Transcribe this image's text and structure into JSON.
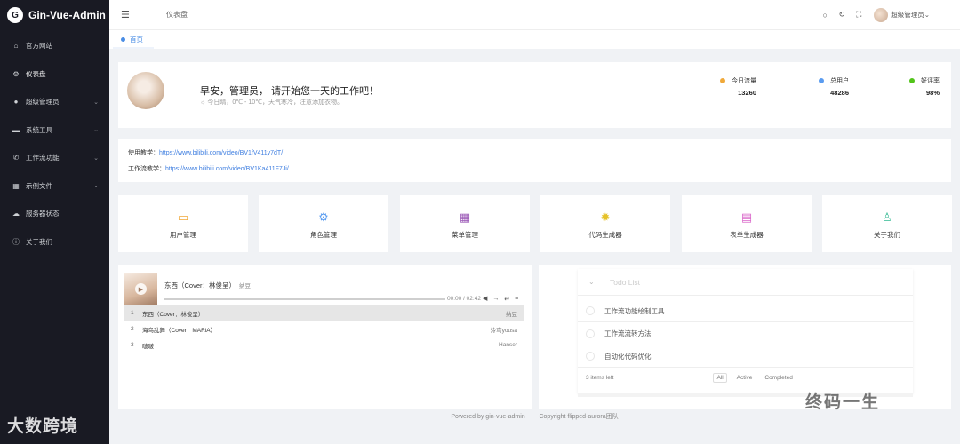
{
  "app": {
    "title": "Gin-Vue-Admin",
    "logo_glyph": "G"
  },
  "sidebar": {
    "items": [
      {
        "label": "官方网站",
        "icon": "home-icon",
        "glyph": "⌂",
        "has_arrow": false
      },
      {
        "label": "仪表盘",
        "icon": "gear-icon",
        "glyph": "⚙",
        "has_arrow": false,
        "active": true
      },
      {
        "label": "超级管理员",
        "icon": "user-icon",
        "glyph": "●",
        "has_arrow": true
      },
      {
        "label": "系统工具",
        "icon": "toolbox-icon",
        "glyph": "▬",
        "has_arrow": true
      },
      {
        "label": "工作流功能",
        "icon": "phone-icon",
        "glyph": "✆",
        "has_arrow": true
      },
      {
        "label": "示例文件",
        "icon": "grid-icon",
        "glyph": "▦",
        "has_arrow": true
      },
      {
        "label": "服务器状态",
        "icon": "cloud-icon",
        "glyph": "☁",
        "has_arrow": false
      },
      {
        "label": "关于我们",
        "icon": "info-icon",
        "glyph": "ⓘ",
        "has_arrow": false
      }
    ],
    "arrow_glyph": "⌄"
  },
  "header": {
    "breadcrumb": "仪表盘",
    "hamburger_glyph": "☰",
    "icons": [
      {
        "name": "search-icon",
        "glyph": "○"
      },
      {
        "name": "refresh-icon",
        "glyph": "↻"
      },
      {
        "name": "fullscreen-icon",
        "glyph": "⛶"
      }
    ],
    "user_name": "超级管理员",
    "dropdown_glyph": "⌄"
  },
  "tabs": [
    {
      "label": "首页",
      "active": true
    }
  ],
  "welcome": {
    "greeting": "早安，管理员， 请开始您一天的工作吧！",
    "weather": "☼ 今日晴，0℃ - 10℃，天气寒冷，注意添加衣物。",
    "stats": [
      {
        "label": "今日流量",
        "value": "13260",
        "color": "#f0a93a"
      },
      {
        "label": "总用户",
        "value": "48286",
        "color": "#5a9cf0"
      },
      {
        "label": "好评率",
        "value": "98%",
        "color": "#52c41a"
      }
    ]
  },
  "links": {
    "usage_label": "使用教学：",
    "usage_url": "https://www.bilibili.com/video/BV1fV411y7dT/",
    "workflow_label": "工作流教学：",
    "workflow_url": "https://www.bilibili.com/video/BV1Ka411F7Ji/"
  },
  "quick_entries": [
    {
      "label": "用户管理",
      "icon": "monitor-icon",
      "glyph": "▭",
      "color": "#f0a93a"
    },
    {
      "label": "角色管理",
      "icon": "settings-icon",
      "glyph": "⚙",
      "color": "#5a9cf0"
    },
    {
      "label": "菜单管理",
      "icon": "menu-grid-icon",
      "glyph": "▦",
      "color": "#9b59b6"
    },
    {
      "label": "代码生成器",
      "icon": "cog-icon",
      "glyph": "✹",
      "color": "#e6c229"
    },
    {
      "label": "表单生成器",
      "icon": "document-icon",
      "glyph": "▤",
      "color": "#d966c9"
    },
    {
      "label": "关于我们",
      "icon": "user-outline-icon",
      "glyph": "♙",
      "color": "#4fc3a1"
    }
  ],
  "player": {
    "current_title": "东西（Cover：林俊呈）",
    "current_artist": "纳豆",
    "time": "00:00 / 02:42",
    "controls": "◀ → ⇄ ≡",
    "play_glyph": "▶",
    "progress": 0,
    "playlist": [
      {
        "num": "1",
        "title": "东西（Cover：林俊呈）",
        "artist": "纳豆",
        "current": true
      },
      {
        "num": "2",
        "title": "海鸟乱舞（Cover：MARiA）",
        "artist": "泠鸢yousa",
        "current": false
      },
      {
        "num": "3",
        "title": "啵啵",
        "artist": "Hanser",
        "current": false
      }
    ]
  },
  "todo": {
    "placeholder": "Todo List",
    "chevron_glyph": "⌄",
    "items": [
      "工作流功能绘制工具",
      "工作流流转方法",
      "自动化代码优化"
    ],
    "items_left": "3 items left",
    "filters": [
      "All",
      "Active",
      "Completed"
    ],
    "selected_filter": "All"
  },
  "footer": {
    "powered": "Powered by gin-vue-admin",
    "separator": "|",
    "copyright": "Copyright flipped-aurora团队"
  },
  "watermarks": {
    "left": "大数跨境",
    "right": "终码一生"
  }
}
